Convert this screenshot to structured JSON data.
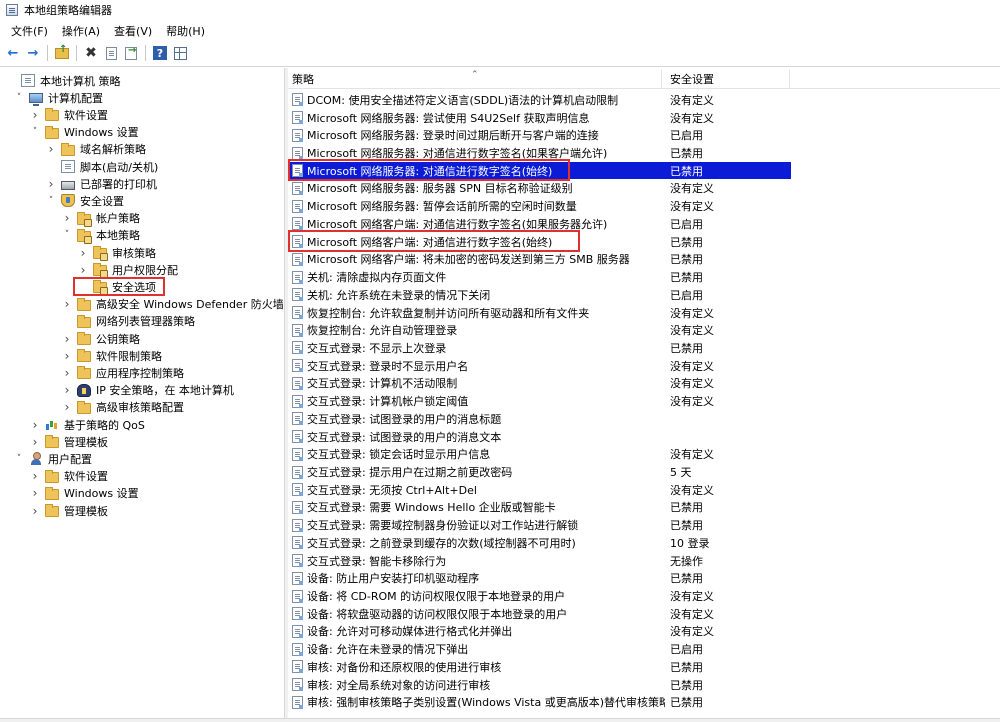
{
  "window": {
    "title": "本地组策略编辑器"
  },
  "menu": [
    "文件(F)",
    "操作(A)",
    "查看(V)",
    "帮助(H)"
  ],
  "toolbar": {
    "icons": [
      "back-arrow-icon",
      "forward-arrow-icon",
      "up-folder-icon",
      "delete-icon",
      "properties-icon",
      "export-list-icon",
      "help-icon",
      "show-hide-tree-icon"
    ]
  },
  "tree": {
    "items": [
      {
        "label": "本地计算机 策略",
        "icon": "policy-icon",
        "chevron": ""
      },
      {
        "label": "计算机配置",
        "icon": "computer-icon",
        "chevron": "v"
      },
      {
        "label": "软件设置",
        "icon": "folder-icon",
        "chevron": ">"
      },
      {
        "label": "Windows 设置",
        "icon": "folder-icon",
        "chevron": "v"
      },
      {
        "label": "域名解析策略",
        "icon": "folder-icon",
        "chevron": ">"
      },
      {
        "label": "脚本(启动/关机)",
        "icon": "script-icon",
        "chevron": ""
      },
      {
        "label": "已部署的打印机",
        "icon": "printer-icon",
        "chevron": ">"
      },
      {
        "label": "安全设置",
        "icon": "security-icon",
        "chevron": "v"
      },
      {
        "label": "帐户策略",
        "icon": "folder-lock-icon",
        "chevron": ">"
      },
      {
        "label": "本地策略",
        "icon": "folder-lock-icon",
        "chevron": "v"
      },
      {
        "label": "审核策略",
        "icon": "folder-lock-icon",
        "chevron": ">"
      },
      {
        "label": "用户权限分配",
        "icon": "folder-lock-icon",
        "chevron": ">"
      },
      {
        "label": "安全选项",
        "icon": "folder-lock-icon",
        "chevron": ""
      },
      {
        "label": "高级安全 Windows Defender 防火墙",
        "icon": "folder-icon",
        "chevron": ">"
      },
      {
        "label": "网络列表管理器策略",
        "icon": "folder-icon",
        "chevron": ""
      },
      {
        "label": "公钥策略",
        "icon": "folder-icon",
        "chevron": ">"
      },
      {
        "label": "软件限制策略",
        "icon": "folder-icon",
        "chevron": ">"
      },
      {
        "label": "应用程序控制策略",
        "icon": "folder-icon",
        "chevron": ">"
      },
      {
        "label": "IP 安全策略，在 本地计算机",
        "icon": "ipsec-icon",
        "chevron": ">"
      },
      {
        "label": "高级审核策略配置",
        "icon": "folder-icon",
        "chevron": ">"
      },
      {
        "label": "基于策略的 QoS",
        "icon": "qos-chart-icon",
        "chevron": ">"
      },
      {
        "label": "管理模板",
        "icon": "folder-icon",
        "chevron": ">"
      },
      {
        "label": "用户配置",
        "icon": "user-icon",
        "chevron": "v"
      },
      {
        "label": "软件设置",
        "icon": "folder-icon",
        "chevron": ">"
      },
      {
        "label": "Windows 设置",
        "icon": "folder-icon",
        "chevron": ">"
      },
      {
        "label": "管理模板",
        "icon": "folder-icon",
        "chevron": ">"
      }
    ]
  },
  "list": {
    "columns": {
      "policy": "策略",
      "setting": "安全设置"
    },
    "rows": [
      {
        "policy": "DCOM: 使用安全描述符定义语言(SDDL)语法的计算机启动限制",
        "setting": "没有定义"
      },
      {
        "policy": "Microsoft 网络服务器: 尝试使用 S4U2Self 获取声明信息",
        "setting": "没有定义"
      },
      {
        "policy": "Microsoft 网络服务器: 登录时间过期后断开与客户端的连接",
        "setting": "已启用"
      },
      {
        "policy": "Microsoft 网络服务器: 对通信进行数字签名(如果客户端允许)",
        "setting": "已禁用"
      },
      {
        "policy": "Microsoft 网络服务器: 对通信进行数字签名(始终)",
        "setting": "已禁用"
      },
      {
        "policy": "Microsoft 网络服务器: 服务器 SPN 目标名称验证级别",
        "setting": "没有定义"
      },
      {
        "policy": "Microsoft 网络服务器: 暂停会话前所需的空闲时间数量",
        "setting": "没有定义"
      },
      {
        "policy": "Microsoft 网络客户端: 对通信进行数字签名(如果服务器允许)",
        "setting": "已启用"
      },
      {
        "policy": "Microsoft 网络客户端: 对通信进行数字签名(始终)",
        "setting": "已禁用"
      },
      {
        "policy": "Microsoft 网络客户端: 将未加密的密码发送到第三方 SMB 服务器",
        "setting": "已禁用"
      },
      {
        "policy": "关机: 清除虚拟内存页面文件",
        "setting": "已禁用"
      },
      {
        "policy": "关机: 允许系统在未登录的情况下关闭",
        "setting": "已启用"
      },
      {
        "policy": "恢复控制台: 允许软盘复制并访问所有驱动器和所有文件夹",
        "setting": "没有定义"
      },
      {
        "policy": "恢复控制台: 允许自动管理登录",
        "setting": "没有定义"
      },
      {
        "policy": "交互式登录: 不显示上次登录",
        "setting": "已禁用"
      },
      {
        "policy": "交互式登录: 登录时不显示用户名",
        "setting": "没有定义"
      },
      {
        "policy": "交互式登录: 计算机不活动限制",
        "setting": "没有定义"
      },
      {
        "policy": "交互式登录: 计算机帐户锁定阈值",
        "setting": "没有定义"
      },
      {
        "policy": "交互式登录: 试图登录的用户的消息标题",
        "setting": ""
      },
      {
        "policy": "交互式登录: 试图登录的用户的消息文本",
        "setting": ""
      },
      {
        "policy": "交互式登录: 锁定会话时显示用户信息",
        "setting": "没有定义"
      },
      {
        "policy": "交互式登录: 提示用户在过期之前更改密码",
        "setting": "5 天"
      },
      {
        "policy": "交互式登录: 无须按 Ctrl+Alt+Del",
        "setting": "没有定义"
      },
      {
        "policy": "交互式登录: 需要 Windows Hello 企业版或智能卡",
        "setting": "已禁用"
      },
      {
        "policy": "交互式登录: 需要域控制器身份验证以对工作站进行解锁",
        "setting": "已禁用"
      },
      {
        "policy": "交互式登录: 之前登录到缓存的次数(域控制器不可用时)",
        "setting": "10 登录"
      },
      {
        "policy": "交互式登录: 智能卡移除行为",
        "setting": "无操作"
      },
      {
        "policy": "设备: 防止用户安装打印机驱动程序",
        "setting": "已禁用"
      },
      {
        "policy": "设备: 将 CD-ROM 的访问权限仅限于本地登录的用户",
        "setting": "没有定义"
      },
      {
        "policy": "设备: 将软盘驱动器的访问权限仅限于本地登录的用户",
        "setting": "没有定义"
      },
      {
        "policy": "设备: 允许对可移动媒体进行格式化并弹出",
        "setting": "没有定义"
      },
      {
        "policy": "设备: 允许在未登录的情况下弹出",
        "setting": "已启用"
      },
      {
        "policy": "审核: 对备份和还原权限的使用进行审核",
        "setting": "已禁用"
      },
      {
        "policy": "审核: 对全局系统对象的访问进行审核",
        "setting": "已禁用"
      },
      {
        "policy": "审核: 强制审核策略子类别设置(Windows Vista 或更高版本)替代审核策略类...",
        "setting": "已禁用"
      }
    ]
  }
}
